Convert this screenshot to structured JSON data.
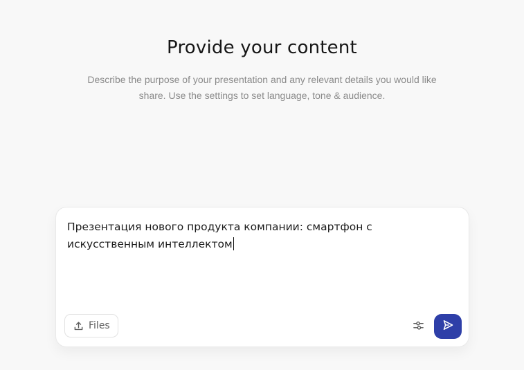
{
  "header": {
    "title": "Provide your content",
    "subtitle": "Describe the purpose of your presentation and any relevant details you would like share. Use the settings to set language, tone & audience."
  },
  "composer": {
    "prompt_value": "Презентация нового продукта компании: смартфон с искусственным интеллектом",
    "files_label": "Files",
    "icons": {
      "upload": "upload-icon",
      "settings": "sliders-icon",
      "send": "send-icon"
    }
  },
  "colors": {
    "background": "#f8f8f8",
    "accent": "#2e3fa8",
    "subtitle_text": "#8a8a8a"
  }
}
